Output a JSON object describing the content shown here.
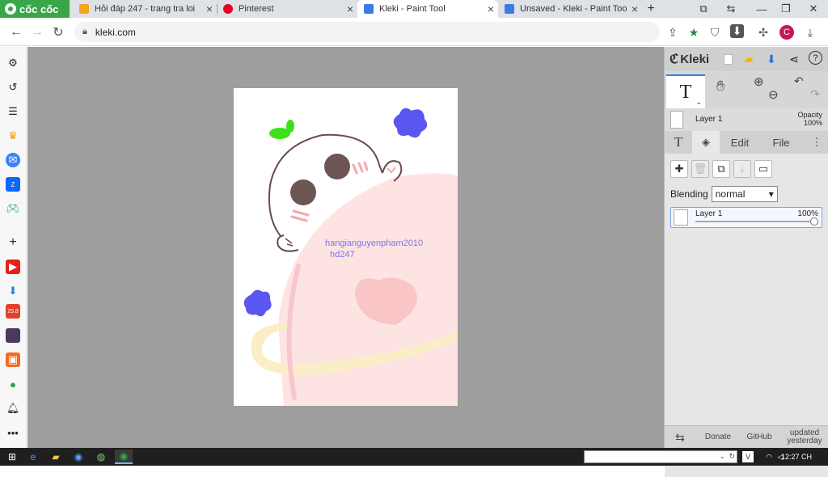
{
  "browser": {
    "brand": "cốc cốc",
    "tabs": [
      {
        "title": "Hỏi đáp 247 - trang tra loi",
        "icon": "hoidap-favicon",
        "color": "#f2a71b"
      },
      {
        "title": "Pinterest",
        "icon": "pinterest-favicon",
        "color": "#e60023"
      },
      {
        "title": "Kleki - Paint Tool",
        "icon": "kleki-favicon",
        "color": "#3b7be8"
      },
      {
        "title": "Unsaved - Kleki - Paint Tool",
        "icon": "kleki-favicon",
        "color": "#3b7be8"
      }
    ],
    "url": "kleki.com",
    "profile_initial": "C"
  },
  "kleki": {
    "app_name": "Kleki",
    "layer_name": "Layer 1",
    "opacity_label": "Opacity",
    "opacity_value": "100%",
    "tabs": {
      "edit": "Edit",
      "file": "File"
    },
    "blending_label": "Blending",
    "blending_value": "normal",
    "layers": [
      {
        "name": "Layer 1",
        "opacity": "100%"
      }
    ],
    "footer": {
      "donate": "Donate",
      "github": "GitHub",
      "updated": "updated yesterday"
    }
  },
  "canvas": {
    "watermark_line1": "hangianguyenpham2010",
    "watermark_line2": "hd247"
  },
  "taskbar": {
    "time": "12:27 CH"
  },
  "colors": {
    "accent": "#3b7be8",
    "brand_green": "#3aa64a",
    "canvas_bg": "#9e9e9e"
  }
}
